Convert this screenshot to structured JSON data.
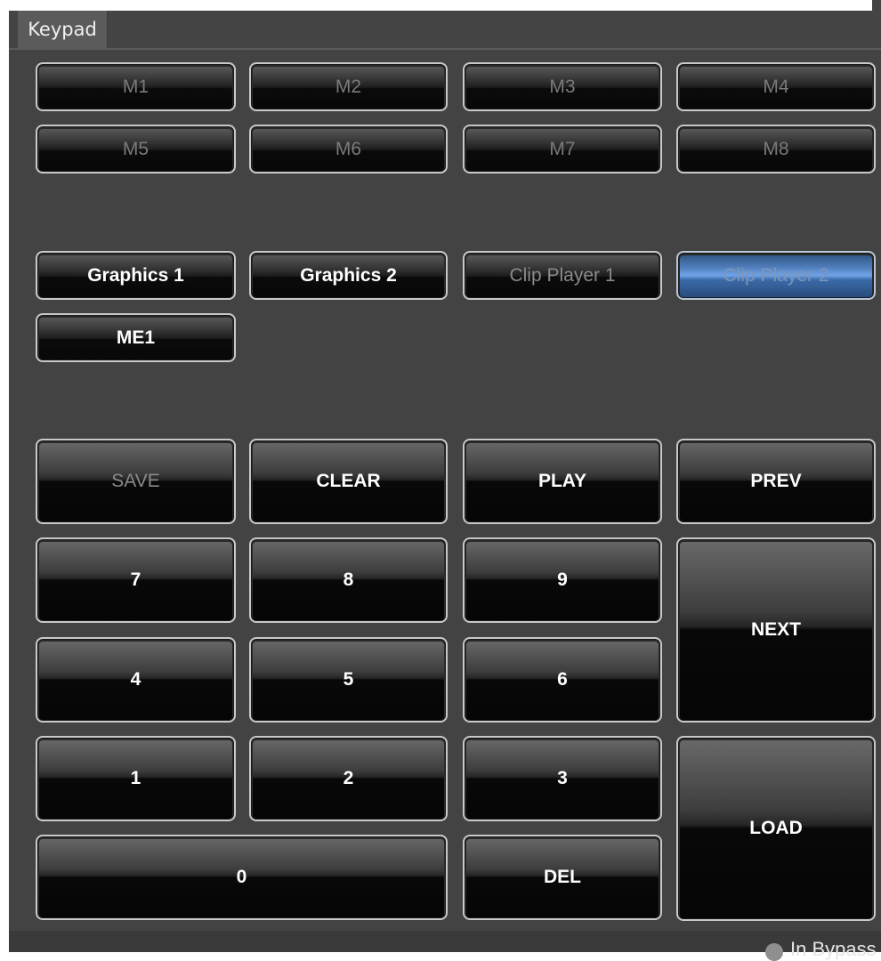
{
  "tab": {
    "label": "Keypad"
  },
  "macros": [
    "M1",
    "M2",
    "M3",
    "M4",
    "M5",
    "M6",
    "M7",
    "M8"
  ],
  "sources": {
    "graphics1": "Graphics 1",
    "graphics2": "Graphics 2",
    "clip1": "Clip Player 1",
    "clip2": "Clip Player 2",
    "me1": "ME1"
  },
  "actions": {
    "save": "SAVE",
    "clear": "CLEAR",
    "play": "PLAY",
    "prev": "PREV",
    "next": "NEXT",
    "load": "LOAD",
    "del": "DEL"
  },
  "digits": {
    "d7": "7",
    "d8": "8",
    "d9": "9",
    "d4": "4",
    "d5": "5",
    "d6": "6",
    "d1": "1",
    "d2": "2",
    "d3": "3",
    "d0": "0"
  },
  "status": {
    "label": "In Bypass"
  },
  "colors": {
    "active_source": "#6fa3e8",
    "panel": "#434343"
  }
}
